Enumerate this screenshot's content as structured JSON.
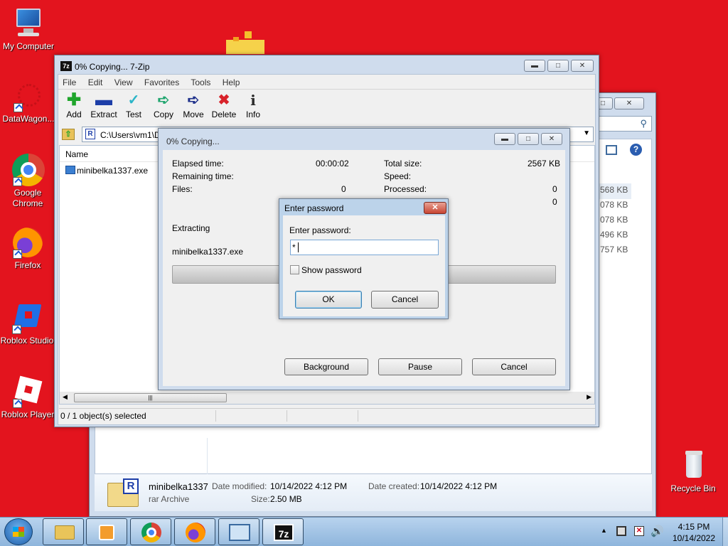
{
  "desktop": {
    "icons": [
      {
        "label": "My Computer"
      },
      {
        "label": "DataWagon..."
      },
      {
        "label": "Google Chrome"
      },
      {
        "label": "Firefox"
      },
      {
        "label": "Roblox Studio"
      },
      {
        "label": "Roblox Player"
      },
      {
        "label": "Recycle Bin"
      }
    ]
  },
  "zip_window": {
    "title": "0% Copying... 7-Zip",
    "menu": [
      "File",
      "Edit",
      "View",
      "Favorites",
      "Tools",
      "Help"
    ],
    "toolbar": [
      {
        "label": "Add",
        "icon": "plus-icon",
        "color": "#1fa52b"
      },
      {
        "label": "Extract",
        "icon": "minus-icon",
        "color": "#1d3ea8"
      },
      {
        "label": "Test",
        "icon": "check-icon",
        "color": "#2bb5c8"
      },
      {
        "label": "Copy",
        "icon": "arrow-right-icon",
        "color": "#1fa56e"
      },
      {
        "label": "Move",
        "icon": "arrow-right-icon",
        "color": "#1d2f8a"
      },
      {
        "label": "Delete",
        "icon": "x-icon",
        "color": "#d8222a"
      },
      {
        "label": "Info",
        "icon": "info-icon",
        "color": "#2a2a2a"
      }
    ],
    "address": "C:\\Users\\vm1\\D",
    "column_name": "Name",
    "file_name": "minibelka1337.exe",
    "status": "0 / 1 object(s) selected"
  },
  "explorer_window": {
    "column_partial": "ribute",
    "sizes": [
      "568 KB",
      "078 KB",
      "078 KB",
      "496 KB",
      "757 KB"
    ],
    "details": {
      "name": "minibelka1337",
      "type": "rar Archive",
      "date_modified_label": "Date modified:",
      "date_modified": "10/14/2022 4:12 PM",
      "date_created_label": "Date created:",
      "date_created": "10/14/2022 4:12 PM",
      "size_label": "Size:",
      "size": "2.50 MB"
    }
  },
  "copy_dialog": {
    "title": "0% Copying...",
    "elapsed_label": "Elapsed time:",
    "elapsed": "00:00:02",
    "remaining_label": "Remaining time:",
    "files_label": "Files:",
    "files": "0",
    "total_label": "Total size:",
    "total": "2567 KB",
    "speed_label": "Speed:",
    "processed_label": "Processed:",
    "processed": "0",
    "processed2": "0",
    "action": "Extracting",
    "current_file": "minibelka1337.exe",
    "progress": 0,
    "buttons": {
      "background": "Background",
      "pause": "Pause",
      "cancel": "Cancel"
    }
  },
  "password_dialog": {
    "title": "Enter password",
    "prompt": "Enter password:",
    "value": "*",
    "show_password": "Show password",
    "show_password_checked": false,
    "ok": "OK",
    "cancel": "Cancel"
  },
  "taskbar": {
    "time": "4:15 PM",
    "date": "10/14/2022"
  },
  "colors": {
    "desktop": "#e3141e",
    "taskbar": "#9cc0e4"
  }
}
